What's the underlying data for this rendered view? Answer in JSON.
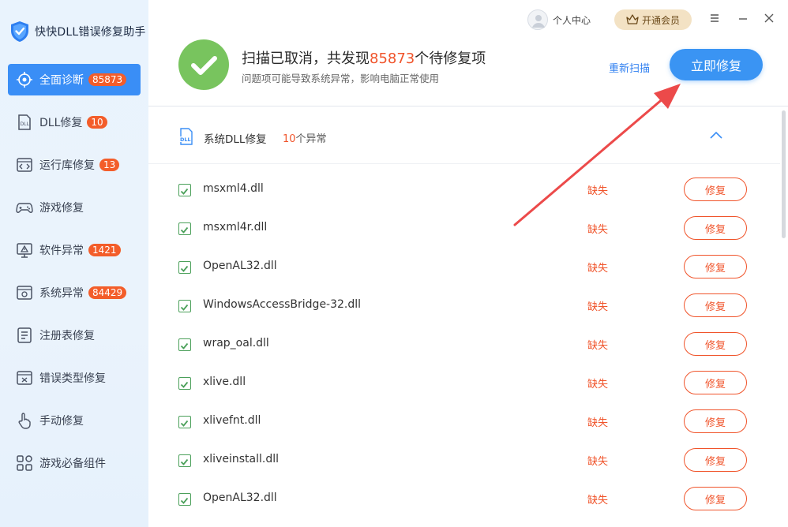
{
  "app": {
    "title": "快快DLL错误修复助手"
  },
  "sidebar": {
    "items": [
      {
        "label": "全面诊断",
        "badge": "85873",
        "icon": "diagnose-icon",
        "active": true
      },
      {
        "label": "DLL修复",
        "badge": "10",
        "icon": "dll-icon"
      },
      {
        "label": "运行库修复",
        "badge": "13",
        "icon": "runtime-icon"
      },
      {
        "label": "游戏修复",
        "badge": "",
        "icon": "gamepad-icon"
      },
      {
        "label": "软件异常",
        "badge": "1421",
        "icon": "warning-icon"
      },
      {
        "label": "系统异常",
        "badge": "84429",
        "icon": "system-icon"
      },
      {
        "label": "注册表修复",
        "badge": "",
        "icon": "registry-icon"
      },
      {
        "label": "错误类型修复",
        "badge": "",
        "icon": "error-type-icon"
      },
      {
        "label": "手动修复",
        "badge": "",
        "icon": "hand-icon"
      },
      {
        "label": "游戏必备组件",
        "badge": "",
        "icon": "grid-icon"
      }
    ]
  },
  "topbar": {
    "user_label": "个人中心",
    "vip_label": "开通会员"
  },
  "status": {
    "title_prefix": "扫描已取消，共发现",
    "count": "85873",
    "title_suffix": "个待修复项",
    "subtitle": "问题项可能导致系统异常，影响电脑正常使用",
    "rescan_label": "重新扫描",
    "fix_now_label": "立即修复"
  },
  "section": {
    "title": "系统DLL修复",
    "count": "10",
    "count_suffix": "个异常"
  },
  "rows": [
    {
      "name": "msxml4.dll",
      "state": "缺失",
      "action": "修复"
    },
    {
      "name": "msxml4r.dll",
      "state": "缺失",
      "action": "修复"
    },
    {
      "name": "OpenAL32.dll",
      "state": "缺失",
      "action": "修复"
    },
    {
      "name": "WindowsAccessBridge-32.dll",
      "state": "缺失",
      "action": "修复"
    },
    {
      "name": "wrap_oal.dll",
      "state": "缺失",
      "action": "修复"
    },
    {
      "name": "xlive.dll",
      "state": "缺失",
      "action": "修复"
    },
    {
      "name": "xlivefnt.dll",
      "state": "缺失",
      "action": "修复"
    },
    {
      "name": "xliveinstall.dll",
      "state": "缺失",
      "action": "修复"
    },
    {
      "name": "OpenAL32.dll",
      "state": "缺失",
      "action": "修复"
    }
  ],
  "colors": {
    "accent": "#3a8ef6",
    "danger": "#f0542b",
    "success": "#78c45e",
    "vip": "#f3e2c4"
  }
}
